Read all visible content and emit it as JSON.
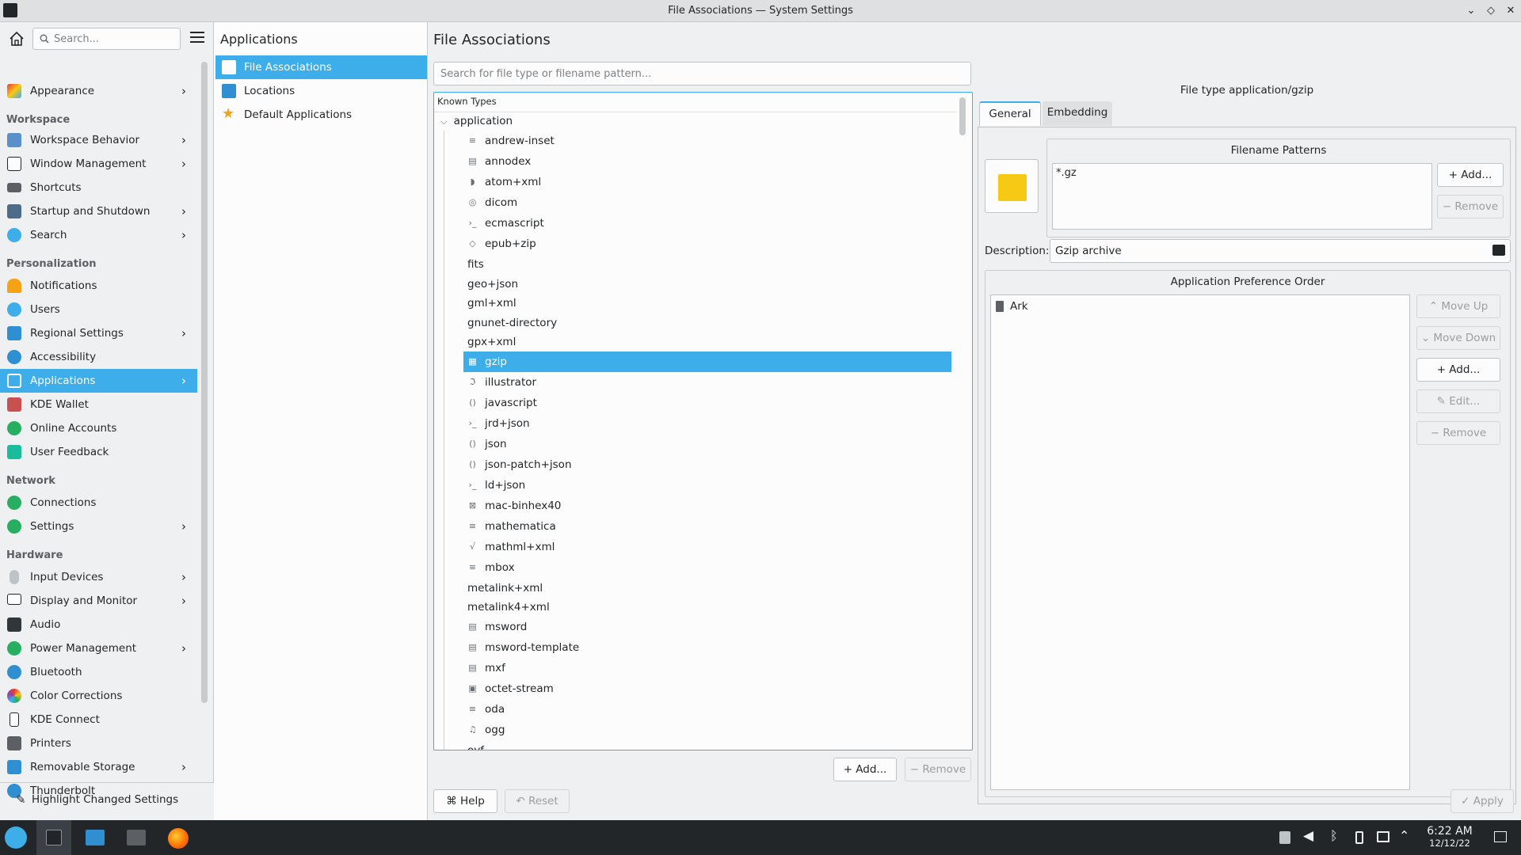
{
  "window": {
    "title": "File Associations — System Settings"
  },
  "sidebar": {
    "search_placeholder": "Search...",
    "top_item": {
      "label": "Appearance",
      "icon": "appearance-icon"
    },
    "categories": {
      "workspace": "Workspace",
      "personalization": "Personalization",
      "network": "Network",
      "hardware": "Hardware"
    },
    "workspace_items": [
      {
        "label": "Workspace Behavior",
        "chevron": true
      },
      {
        "label": "Window Management",
        "chevron": true
      },
      {
        "label": "Shortcuts",
        "chevron": false
      },
      {
        "label": "Startup and Shutdown",
        "chevron": true
      },
      {
        "label": "Search",
        "chevron": true
      }
    ],
    "personalization_items": [
      {
        "label": "Notifications",
        "chevron": false
      },
      {
        "label": "Users",
        "chevron": false
      },
      {
        "label": "Regional Settings",
        "chevron": true
      },
      {
        "label": "Accessibility",
        "chevron": false
      },
      {
        "label": "Applications",
        "chevron": true,
        "active": true
      },
      {
        "label": "KDE Wallet",
        "chevron": false
      },
      {
        "label": "Online Accounts",
        "chevron": false
      },
      {
        "label": "User Feedback",
        "chevron": false
      }
    ],
    "network_items": [
      {
        "label": "Connections",
        "chevron": false
      },
      {
        "label": "Settings",
        "chevron": true
      }
    ],
    "hardware_items": [
      {
        "label": "Input Devices",
        "chevron": true
      },
      {
        "label": "Display and Monitor",
        "chevron": true
      },
      {
        "label": "Audio",
        "chevron": false
      },
      {
        "label": "Power Management",
        "chevron": true
      },
      {
        "label": "Bluetooth",
        "chevron": false
      },
      {
        "label": "Color Corrections",
        "chevron": false
      },
      {
        "label": "KDE Connect",
        "chevron": false
      },
      {
        "label": "Printers",
        "chevron": false
      },
      {
        "label": "Removable Storage",
        "chevron": true
      },
      {
        "label": "Thunderbolt",
        "chevron": false
      }
    ],
    "footer_label": "Highlight Changed Settings"
  },
  "subpanel": {
    "title": "Applications",
    "items": [
      {
        "label": "File Associations",
        "active": true
      },
      {
        "label": "Locations",
        "active": false
      },
      {
        "label": "Default Applications",
        "active": false
      }
    ]
  },
  "main": {
    "title": "File Associations",
    "search_placeholder": "Search for file type or filename pattern...",
    "tree_header": "Known Types",
    "root_label": "application",
    "types": [
      {
        "label": "andrew-inset",
        "icon": "≡"
      },
      {
        "label": "annodex",
        "icon": "▤"
      },
      {
        "label": "atom+xml",
        "icon": "◗"
      },
      {
        "label": "dicom",
        "icon": "◎"
      },
      {
        "label": "ecmascript",
        "icon": "›_"
      },
      {
        "label": "epub+zip",
        "icon": "◇"
      },
      {
        "label": "fits",
        "icon": ""
      },
      {
        "label": "geo+json",
        "icon": ""
      },
      {
        "label": "gml+xml",
        "icon": ""
      },
      {
        "label": "gnunet-directory",
        "icon": ""
      },
      {
        "label": "gpx+xml",
        "icon": ""
      },
      {
        "label": "gzip",
        "icon": "▦",
        "selected": true
      },
      {
        "label": "illustrator",
        "icon": "ℑ"
      },
      {
        "label": "javascript",
        "icon": "()"
      },
      {
        "label": "jrd+json",
        "icon": "›_"
      },
      {
        "label": "json",
        "icon": "()"
      },
      {
        "label": "json-patch+json",
        "icon": "()"
      },
      {
        "label": "ld+json",
        "icon": "›_"
      },
      {
        "label": "mac-binhex40",
        "icon": "⊠"
      },
      {
        "label": "mathematica",
        "icon": "≡"
      },
      {
        "label": "mathml+xml",
        "icon": "√"
      },
      {
        "label": "mbox",
        "icon": "≡"
      },
      {
        "label": "metalink+xml",
        "icon": ""
      },
      {
        "label": "metalink4+xml",
        "icon": ""
      },
      {
        "label": "msword",
        "icon": "▤"
      },
      {
        "label": "msword-template",
        "icon": "▤"
      },
      {
        "label": "mxf",
        "icon": "▤"
      },
      {
        "label": "octet-stream",
        "icon": "▣"
      },
      {
        "label": "oda",
        "icon": "≡"
      },
      {
        "label": "ogg",
        "icon": "♫"
      },
      {
        "label": "ovf",
        "icon": ""
      }
    ],
    "add_label": "Add...",
    "remove_label": "Remove",
    "help_label": "Help",
    "reset_label": "Reset"
  },
  "details": {
    "file_type_title": "File type application/gzip",
    "tabs": [
      "General",
      "Embedding"
    ],
    "filename_patterns_title": "Filename Patterns",
    "patterns": [
      "*.gz"
    ],
    "add_label": "Add...",
    "remove_label": "Remove",
    "description_label": "Description:",
    "description_value": "Gzip archive",
    "pref_order_title": "Application Preference Order",
    "applications": [
      "Ark"
    ],
    "move_up_label": "Move Up",
    "move_down_label": "Move Down",
    "app_add_label": "Add...",
    "edit_label": "Edit...",
    "app_remove_label": "Remove",
    "apply_label": "Apply"
  },
  "taskbar": {
    "time": "6:22 AM",
    "date": "12/12/22"
  },
  "colors": {
    "accent": "#3daee9",
    "folder": "#f6c915"
  }
}
